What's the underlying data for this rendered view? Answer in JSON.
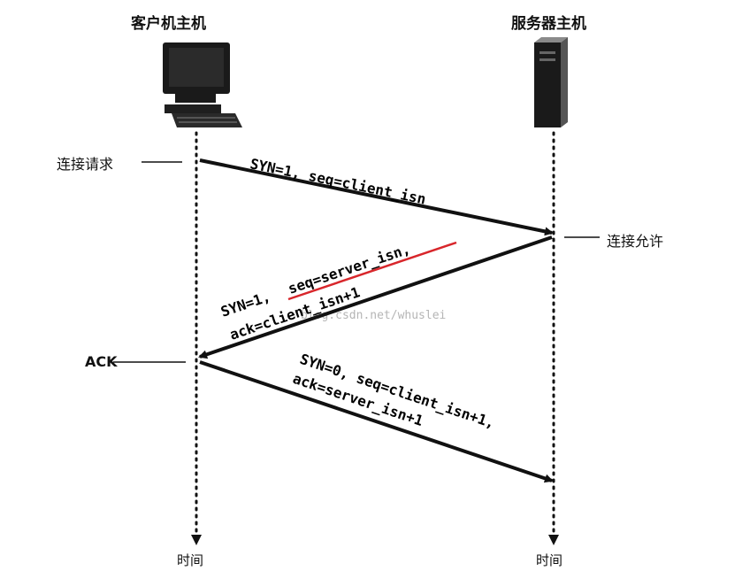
{
  "hosts": {
    "client": "客户机主机",
    "server": "服务器主机"
  },
  "side_labels": {
    "connection_request": "连接请求",
    "connection_granted": "连接允许",
    "ack": "ACK"
  },
  "time_label": "时间",
  "messages": {
    "syn": "SYN=1, seq=client_isn",
    "synack_line1": "SYN=1,",
    "synack_seq": "seq=server_isn,",
    "synack_ack": "ack=client_isn+1",
    "ack_line1": "SYN=0, seq=client_isn+1,",
    "ack_line2": "ack=server_isn+1"
  },
  "watermark": "blog.csdn.net/whuslei",
  "colors": {
    "ink": "#111111",
    "highlight": "#d8262b",
    "watermark": "#b5b5b5"
  },
  "icons": {
    "client": "desktop-computer-icon",
    "server": "server-tower-icon"
  }
}
